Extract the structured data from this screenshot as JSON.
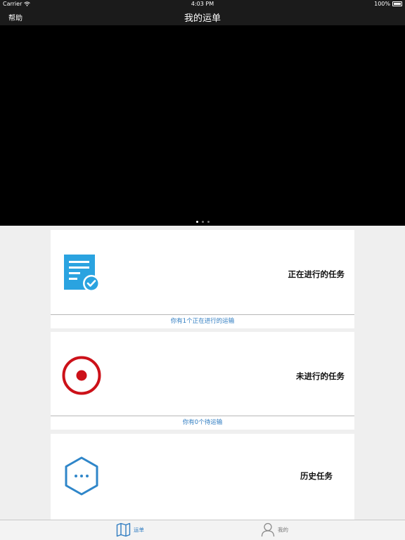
{
  "status_bar": {
    "carrier": "Carrier",
    "time": "4:03 PM",
    "battery": "100%"
  },
  "nav": {
    "help": "帮助",
    "title": "我的运单"
  },
  "cards": [
    {
      "title": "正在进行的任务",
      "footer": "你有1个正在进行的运输",
      "icon": "document-check-icon",
      "color": "#2aa3e0"
    },
    {
      "title": "未进行的任务",
      "footer": "你有0个待运输",
      "icon": "record-icon",
      "color": "#cc1119"
    },
    {
      "title": "历史任务",
      "footer": "",
      "icon": "hexagon-more-icon",
      "color": "#2f86c9"
    }
  ],
  "tabs": [
    {
      "label": "运单",
      "icon": "map-icon",
      "active": true
    },
    {
      "label": "我的",
      "icon": "person-icon",
      "active": false
    }
  ],
  "colors": {
    "accent": "#2f7cc1",
    "header_bg": "#1b1b1b",
    "page_bg": "#efefef"
  }
}
